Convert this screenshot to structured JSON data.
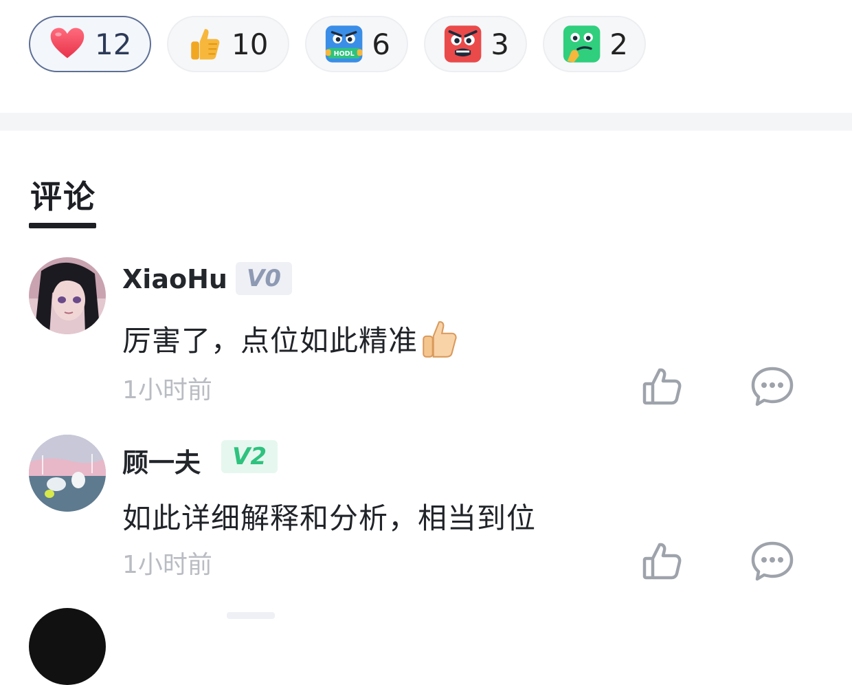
{
  "reactions": [
    {
      "icon": "heart-icon",
      "count": "12",
      "active": true
    },
    {
      "icon": "thumbs-up-icon",
      "count": "10",
      "active": false
    },
    {
      "icon": "hodl-icon",
      "count": "6",
      "active": false
    },
    {
      "icon": "angry-face-icon",
      "count": "3",
      "active": false
    },
    {
      "icon": "thinking-face-icon",
      "count": "2",
      "active": false
    }
  ],
  "section": {
    "title": "评论"
  },
  "comments": [
    {
      "user": "XiaoHu",
      "level": "V0",
      "text": "厉害了，点位如此精准",
      "emoji": "thumbs-up-icon",
      "time": "1小时前"
    },
    {
      "user": "顾一夫",
      "level": "V2",
      "text": "如此详细解释和分析，相当到位",
      "time": "1小时前"
    }
  ],
  "colors": {
    "accent": "#5d6f94",
    "level_v0": "#8e9ab3",
    "level_v2": "#2ec27e",
    "muted": "#b9bcc2"
  }
}
